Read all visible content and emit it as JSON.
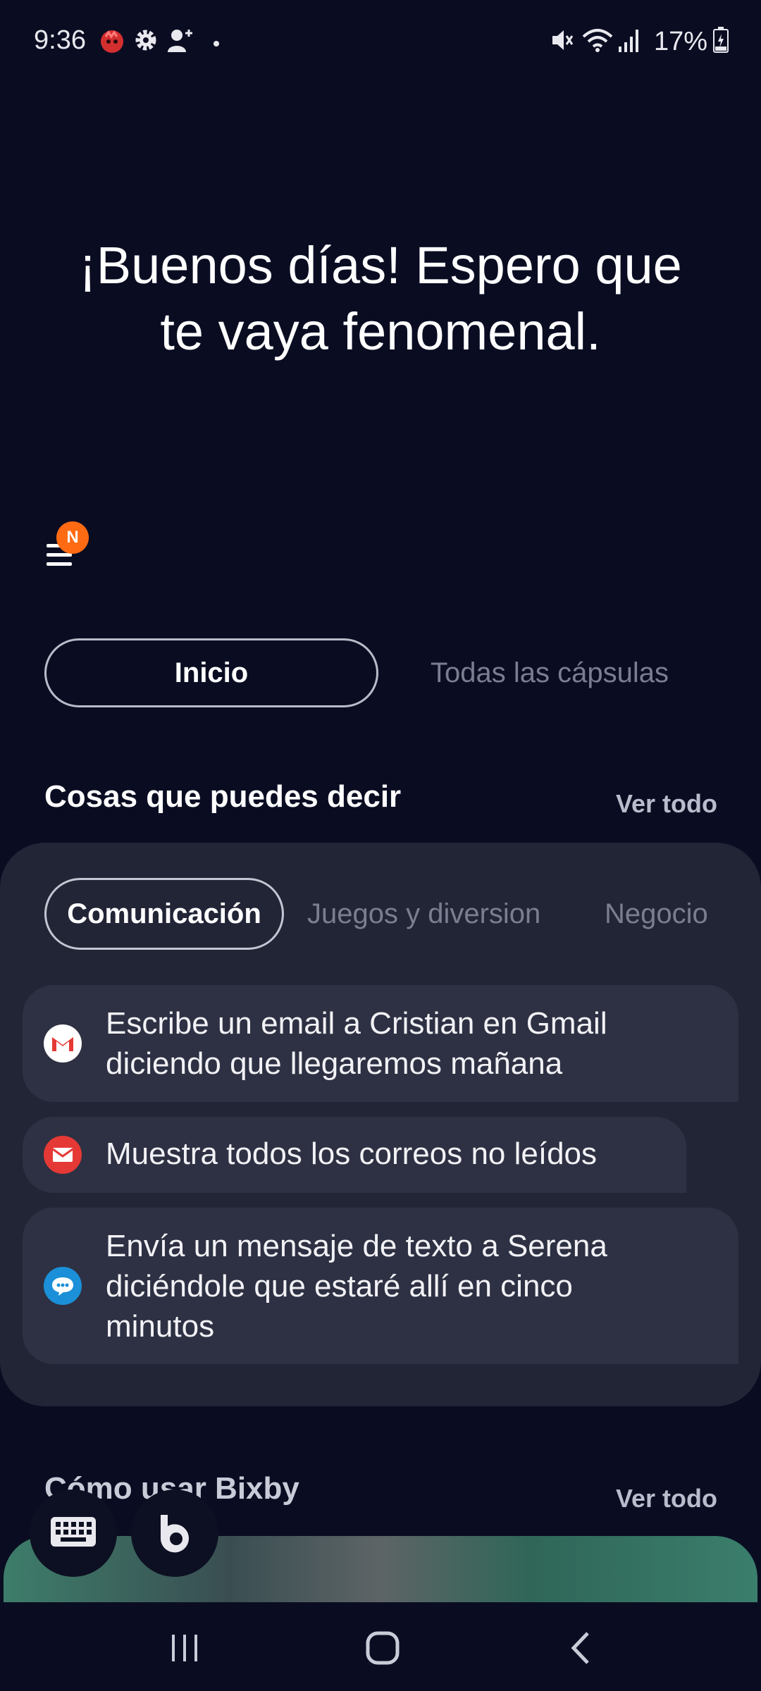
{
  "status_bar": {
    "time": "9:36",
    "battery_percent": "17%",
    "icons_left": [
      "app-notification-icon",
      "settings-icon",
      "add-user-icon",
      "dot-icon"
    ],
    "icons_right": [
      "mute-icon",
      "wifi-icon",
      "signal-icon",
      "battery-charging-icon"
    ]
  },
  "greeting": {
    "line1": "¡Buenos días! Espero que",
    "line2": "te vaya fenomenal."
  },
  "menu": {
    "badge": "N"
  },
  "top_tabs": {
    "active": "Inicio",
    "inactive": "Todas las cápsulas"
  },
  "section_suggestions": {
    "title": "Cosas que puedes decir",
    "see_all": "Ver todo",
    "categories": [
      "Comunicación",
      "Juegos y diversion",
      "Negocio"
    ],
    "items": [
      {
        "line1": "Escribe un email a Cristian en Gmail",
        "line2": "diciendo que llegaremos mañana",
        "icon": "gmail-icon"
      },
      {
        "line1": "Muestra todos los correos no leídos",
        "icon": "email-icon"
      },
      {
        "line1": "Envía un mensaje de texto a Serena",
        "line2": "diciéndole que estaré allí en cinco",
        "line3": "minutos",
        "icon": "messages-icon"
      }
    ]
  },
  "section_howto": {
    "title": "Cómo usar Bixby",
    "see_all": "Ver todo"
  },
  "colors": {
    "background": "#0a0d22",
    "card": "#222536",
    "suggestion": "#2e3143",
    "badge": "#ff6a13",
    "gmail_red": "#e53935",
    "messages_blue": "#1b8fd8"
  }
}
